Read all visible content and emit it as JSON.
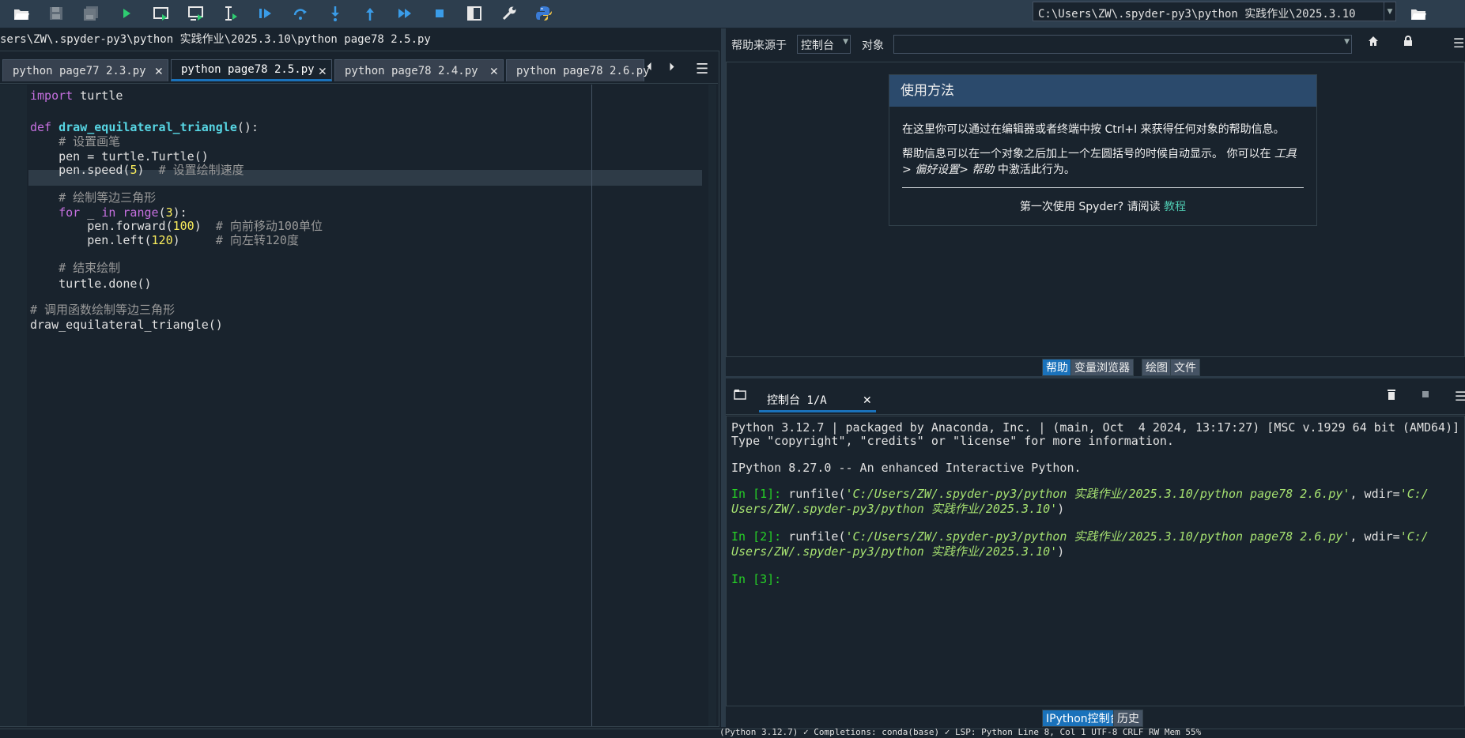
{
  "toolbar": {
    "buttons": [
      {
        "name": "open-file-icon"
      },
      {
        "name": "save-icon"
      },
      {
        "name": "save-all-icon"
      },
      {
        "name": "run-icon"
      },
      {
        "name": "run-cell-icon"
      },
      {
        "name": "run-cell-advance-icon"
      },
      {
        "name": "run-selection-icon"
      },
      {
        "name": "debug-icon"
      },
      {
        "name": "step-icon"
      },
      {
        "name": "step-into-icon"
      },
      {
        "name": "step-return-icon"
      },
      {
        "name": "continue-icon"
      },
      {
        "name": "stop-debug-icon"
      },
      {
        "name": "maximize-pane-icon"
      },
      {
        "name": "preferences-icon"
      },
      {
        "name": "python-path-icon"
      }
    ],
    "working_dir": "C:\\Users\\ZW\\.spyder-py3\\python 实践作业\\2025.3.10"
  },
  "editor": {
    "path": "sers\\ZW\\.spyder-py3\\python 实践作业\\2025.3.10\\python  page78 2.5.py",
    "tabs": [
      {
        "label": "python page77   2.3.py",
        "active": false
      },
      {
        "label": "python  page78 2.5.py",
        "active": true
      },
      {
        "label": "python   page78   2.4.py",
        "active": false
      },
      {
        "label": "python page78 2.6.py",
        "active": false
      }
    ],
    "close_glyph": "✕",
    "nav_prev": "⏴",
    "nav_next": "⏵",
    "menu_glyph": "☰",
    "code": {
      "l1_kw": "import",
      "l1_rest": " turtle",
      "l3_kw": "def",
      "l3_fn": "draw_equilateral_triangle",
      "l3_rest": "():",
      "l4": "    # 设置画笔",
      "l5": "    pen = turtle.Turtle()",
      "l6_a": "    pen.speed(",
      "l6_num": "5",
      "l6_b": ")  ",
      "l6_cm": "# 设置绘制速度",
      "l8": "    # 绘制等边三角形",
      "l9_a": "    ",
      "l9_kw": "for",
      "l9_b": " _ ",
      "l9_kw2": "in",
      "l9_c": " ",
      "l9_bi": "range",
      "l9_d": "(",
      "l9_num": "3",
      "l9_e": "):",
      "l10_a": "        pen.forward(",
      "l10_num": "100",
      "l10_b": ")  ",
      "l10_cm": "# 向前移动100单位",
      "l11_a": "        pen.left(",
      "l11_num": "120",
      "l11_b": ")     ",
      "l11_cm": "# 向左转120度",
      "l13": "    # 结束绘制",
      "l14": "    turtle.done()",
      "l16": "# 调用函数绘制等边三角形",
      "l17": "draw_equilateral_triangle()"
    }
  },
  "help": {
    "source_label": "帮助来源于",
    "source_value": "控制台",
    "object_label": "对象",
    "object_value": "",
    "card_title": "使用方法",
    "card_p1": "在这里你可以通过在编辑器或者终端中按 Ctrl+I 来获得任何对象的帮助信息。",
    "card_p2_a": "帮助信息可以在一个对象之后加上一个左圆括号的时候自动显示。 你可以在 ",
    "card_p2_b": "工具> 偏好设置> 帮助",
    "card_p2_c": " 中激活此行为。",
    "card_foot": "第一次使用 Spyder? 请阅读 ",
    "card_link": "教程",
    "tabs": [
      "帮助",
      "变量浏览器",
      "绘图",
      "文件"
    ]
  },
  "console": {
    "tab_label": "控制台 1/A",
    "lines": {
      "c1": "Python 3.12.7 | packaged by Anaconda, Inc. | (main, Oct  4 2024, 13:17:27) [MSC v.1929 64 bit (AMD64)]",
      "c2": "Type \"copyright\", \"credits\" or \"license\" for more information.",
      "c4": "IPython 8.27.0 -- An enhanced Interactive Python.",
      "p1": "In [1]:",
      "r1_a": " runfile(",
      "r1_s1": "'C:/Users/ZW/.spyder-py3/python 实践作业/2025.3.10/python page78 2.6.py'",
      "r1_b": ", wdir=",
      "r1_s2": "'C:/",
      "r1_s3": "Users/ZW/.spyder-py3/python 实践作业/2025.3.10'",
      "r1_c": ")",
      "p2": "In [2]:",
      "p3": "In [3]:"
    },
    "tabs": [
      "IPython控制台",
      "历史"
    ]
  },
  "status": {
    "text": "(Python 3.12.7)  ✓ Completions: conda(base)  ✓ LSP: Python  Line 8, Col 1  UTF-8  CRLF  RW  Mem 55%"
  },
  "colors": {
    "background": "#19232d",
    "accent": "#1a72bb",
    "help_title_bg": "#2b4a6c"
  }
}
